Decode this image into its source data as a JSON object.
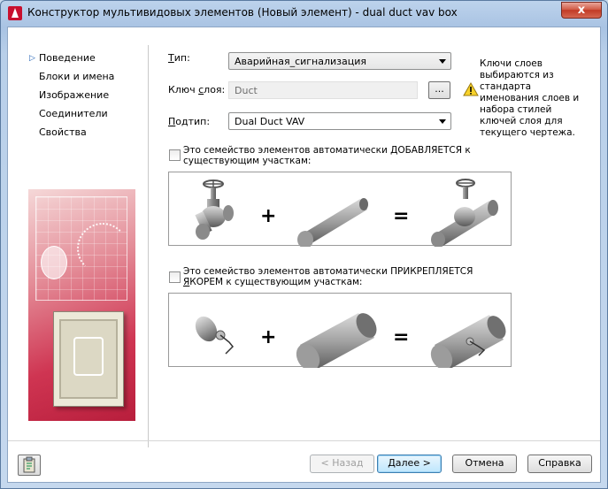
{
  "window": {
    "title": "Конструктор мультивидовых элементов (Новый элемент) - dual duct vav box",
    "close_glyph": "x"
  },
  "nav": {
    "marker": "▷",
    "items": [
      {
        "label": "Поведение",
        "selected": true
      },
      {
        "label": "Блоки и имена"
      },
      {
        "label": "Изображение"
      },
      {
        "label": "Соединители"
      },
      {
        "label": "Свойства"
      }
    ]
  },
  "form": {
    "type": {
      "label_u": "Т",
      "label_rest": "ип:",
      "value": "Аварийная_сигнализация"
    },
    "layer_key": {
      "label_pre": "Ключ ",
      "label_u": "с",
      "label_rest": "лоя:",
      "value": "Duct",
      "browse_label": "..."
    },
    "subtype": {
      "label_u": "П",
      "label_rest": "одтип:",
      "value": "Dual Duct VAV"
    }
  },
  "warning": {
    "text": "Ключи слоев выбираются из стандарта именования слоев и набора стилей ключей слоя для текущего чертежа.",
    "icon": "warning-icon"
  },
  "options": {
    "add": {
      "label_pre": "Это семейство элементов автоматически ",
      "label_u": "Д",
      "label_rest": "ОБАВЛЯЕТСЯ к существующим участкам:",
      "checked": false
    },
    "anchor": {
      "label_pre": "Это семейство элементов автоматически ПРИКРЕПЛЯЕТСЯ ",
      "label_u": "Я",
      "label_rest": "КОРЕМ к существующим участкам:",
      "checked": false
    }
  },
  "operators": {
    "plus": "+",
    "equals": "="
  },
  "buttons": {
    "back": "< Назад",
    "next": "Далее >",
    "cancel": "Отмена",
    "help": "Справка"
  },
  "colors": {
    "accent": "#1e5fb4",
    "title_close": "#c23b25",
    "picture_red": "#cf3552"
  }
}
